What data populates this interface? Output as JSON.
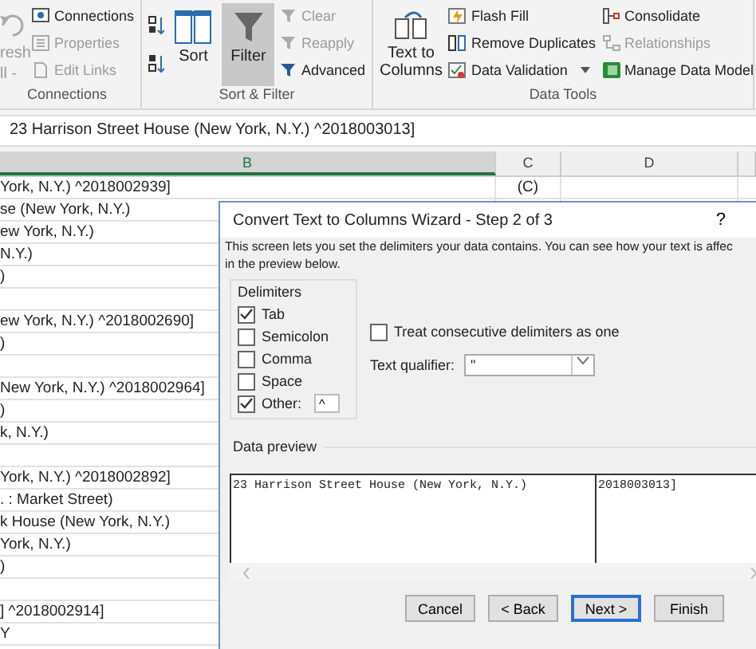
{
  "ribbon": {
    "refresh": {
      "label": "resh",
      "sub": "ll -",
      "disabled": true
    },
    "connections": {
      "label": "Connections",
      "disabled": false
    },
    "properties": {
      "label": "Properties",
      "disabled": true
    },
    "edit_links": {
      "label": "Edit Links",
      "disabled": true
    },
    "connections_group": "Connections",
    "sort": {
      "label": "Sort"
    },
    "filter": {
      "label": "Filter",
      "selected": true
    },
    "clear": {
      "label": "Clear",
      "disabled": true
    },
    "reapply": {
      "label": "Reapply",
      "disabled": true
    },
    "advanced": {
      "label": "Advanced",
      "disabled": false
    },
    "sort_filter_group": "Sort & Filter",
    "text_to_columns": {
      "label": "Text to Columns"
    },
    "flash_fill": {
      "label": "Flash Fill",
      "disabled": false
    },
    "remove_duplicates": {
      "label": "Remove Duplicates",
      "disabled": false
    },
    "data_validation": {
      "label": "Data Validation",
      "disabled": false
    },
    "consolidate": {
      "label": "Consolidate",
      "disabled": false
    },
    "relationships": {
      "label": "Relationships",
      "disabled": true
    },
    "manage_data_model": {
      "label": "Manage Data Model",
      "disabled": false
    },
    "data_tools_group": "Data Tools"
  },
  "formula_bar": {
    "value": "23 Harrison Street House (New York, N.Y.)   ^2018003013]"
  },
  "sheet": {
    "columns": [
      {
        "label": "B",
        "selected": true
      },
      {
        "label": "C",
        "selected": false
      },
      {
        "label": "D",
        "selected": false
      }
    ],
    "rows": [
      {
        "b": "York, N.Y.)   ^2018002939]",
        "c": "(C)"
      },
      {
        "b": "se (New York, N.Y.)"
      },
      {
        "b": "ew York, N.Y.)"
      },
      {
        "b": "N.Y.)"
      },
      {
        "b": ")"
      },
      {},
      {
        "b": "ew York, N.Y.)   ^2018002690]"
      },
      {
        "b": ")"
      },
      {},
      {
        "b": "New York, N.Y.)   ^2018002964]"
      },
      {
        "b": ")"
      },
      {
        "b": "k, N.Y.)"
      },
      {},
      {
        "b": "York, N.Y.)   ^2018002892]"
      },
      {
        "b": ". : Market Street)"
      },
      {
        "b": "k House (New York, N.Y.)"
      },
      {
        "b": "York, N.Y.)"
      },
      {
        "b": ")"
      },
      {},
      {
        "b": "]   ^2018002914]"
      },
      {
        "b": "Y"
      }
    ]
  },
  "dialog": {
    "title": "Convert Text to Columns Wizard - Step 2 of 3",
    "help": "?",
    "description": "This screen lets you set the delimiters your data contains.  You can see how your text is affec",
    "description_2": "in the preview below.",
    "delimiters": {
      "label": "Delimiters",
      "options": [
        {
          "label": "Tab",
          "checked": true
        },
        {
          "label": "Semicolon",
          "checked": false
        },
        {
          "label": "Comma",
          "checked": false
        },
        {
          "label": "Space",
          "checked": false
        },
        {
          "label": "Other:",
          "checked": true,
          "value": "^"
        }
      ]
    },
    "treat_consecutive": {
      "label": "Treat consecutive delimiters as one",
      "checked": false
    },
    "text_qualifier": {
      "label": "Text qualifier:",
      "value": "\""
    },
    "preview": {
      "label": "Data preview",
      "columns": [
        "23 Harrison Street House (New York, N.Y.)",
        "2018003013]"
      ]
    },
    "buttons": [
      {
        "label": "Cancel",
        "default": false
      },
      {
        "label": "< Back",
        "default": false
      },
      {
        "label": "Next >",
        "default": true
      },
      {
        "label": "Finish",
        "default": false
      }
    ]
  }
}
